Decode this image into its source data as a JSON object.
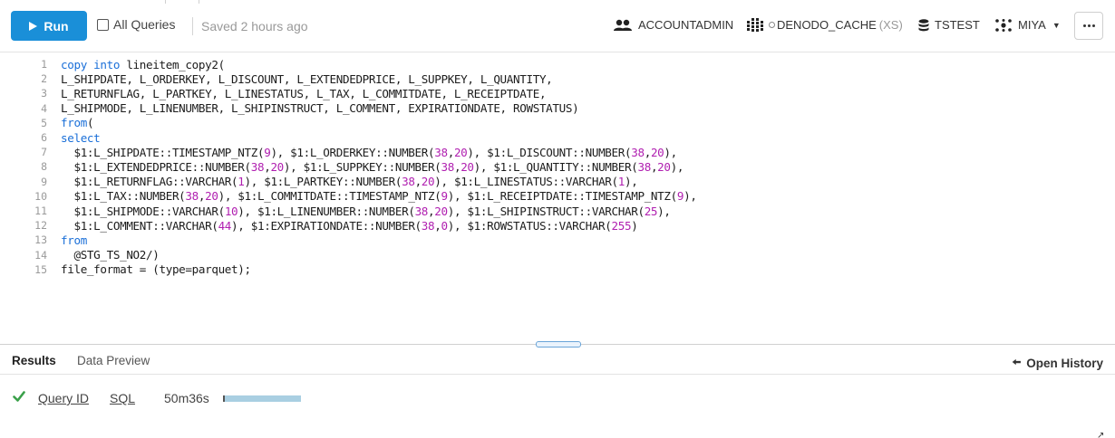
{
  "toolbar": {
    "run_label": "Run",
    "all_queries_label": "All Queries",
    "all_queries_checked": false,
    "saved_text": "Saved 2 hours ago",
    "role": "ACCOUNTADMIN",
    "warehouse": "DENODO_CACHE",
    "warehouse_size": "(XS)",
    "database": "TSTEST",
    "schema": "MIYA",
    "icons": [
      "play-icon",
      "users-icon",
      "warehouse-grid-icon",
      "database-icon",
      "schema-icon",
      "chevron-down-icon",
      "more-icon"
    ]
  },
  "editor": {
    "lines": [
      {
        "n": "1",
        "code": "copy into lineitem_copy2("
      },
      {
        "n": "2",
        "code": "L_SHIPDATE, L_ORDERKEY, L_DISCOUNT, L_EXTENDEDPRICE, L_SUPPKEY, L_QUANTITY,"
      },
      {
        "n": "3",
        "code": "L_RETURNFLAG, L_PARTKEY, L_LINESTATUS, L_TAX, L_COMMITDATE, L_RECEIPTDATE,"
      },
      {
        "n": "4",
        "code": "L_SHIPMODE, L_LINENUMBER, L_SHIPINSTRUCT, L_COMMENT, EXPIRATIONDATE, ROWSTATUS)"
      },
      {
        "n": "5",
        "code": "from("
      },
      {
        "n": "6",
        "code": "select"
      },
      {
        "n": "7",
        "code": "  $1:L_SHIPDATE::TIMESTAMP_NTZ(9), $1:L_ORDERKEY::NUMBER(38,20), $1:L_DISCOUNT::NUMBER(38,20),"
      },
      {
        "n": "8",
        "code": "  $1:L_EXTENDEDPRICE::NUMBER(38,20), $1:L_SUPPKEY::NUMBER(38,20), $1:L_QUANTITY::NUMBER(38,20),"
      },
      {
        "n": "9",
        "code": "  $1:L_RETURNFLAG::VARCHAR(1), $1:L_PARTKEY::NUMBER(38,20), $1:L_LINESTATUS::VARCHAR(1),"
      },
      {
        "n": "10",
        "code": "  $1:L_TAX::NUMBER(38,20), $1:L_COMMITDATE::TIMESTAMP_NTZ(9), $1:L_RECEIPTDATE::TIMESTAMP_NTZ(9),"
      },
      {
        "n": "11",
        "code": "  $1:L_SHIPMODE::VARCHAR(10), $1:L_LINENUMBER::NUMBER(38,20), $1:L_SHIPINSTRUCT::VARCHAR(25),"
      },
      {
        "n": "12",
        "code": "  $1:L_COMMENT::VARCHAR(44), $1:EXPIRATIONDATE::NUMBER(38,0), $1:ROWSTATUS::VARCHAR(255)"
      },
      {
        "n": "13",
        "code": "from"
      },
      {
        "n": "14",
        "code": "  @STG_TS_NO2/)"
      },
      {
        "n": "15",
        "code": "file_format = (type=parquet);"
      }
    ]
  },
  "results": {
    "tab_results": "Results",
    "tab_data_preview": "Data Preview",
    "open_history": "Open History",
    "query_id_label": "Query ID",
    "sql_label": "SQL",
    "duration": "50m36s",
    "status_icon": "check-icon"
  },
  "colors": {
    "run_button": "#1a8fd8",
    "keyword": "#1a6fd8",
    "number": "#b01fb0",
    "success": "#3aa04a",
    "progress": "#a9cfe2"
  }
}
